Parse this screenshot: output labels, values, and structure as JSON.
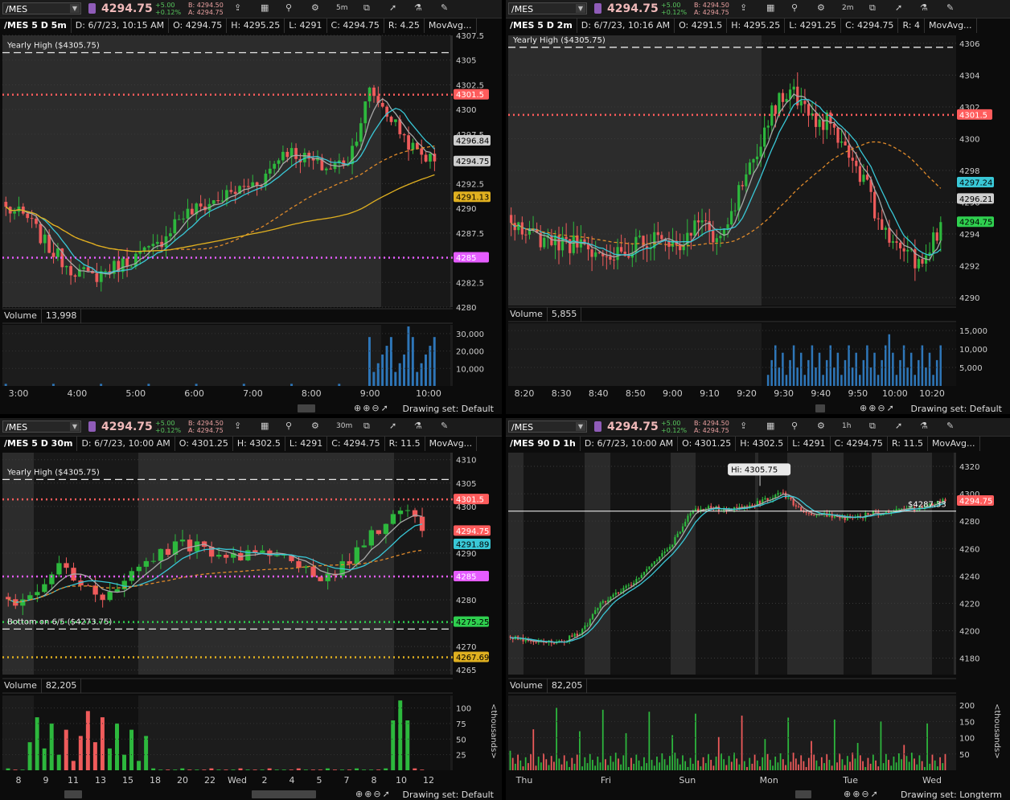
{
  "panes": [
    {
      "id": "tl",
      "symbol": "/MES",
      "last": "4294.75",
      "change": "+5.00",
      "change_pct": "+0.12%",
      "bid": "B: 4294.50",
      "ask": "A: 4294.75",
      "timeframe_btn": "5m",
      "info": {
        "title": "/MES 5 D 5m",
        "date": "D: 6/7/23, 10:15 AM",
        "open": "O: 4294.75",
        "high": "H: 4295.25",
        "low": "L: 4291",
        "close": "C: 4294.75",
        "range": "R: 4.25",
        "studies": "MovAvg..."
      },
      "volume_label": "Volume",
      "volume_value": "13,998",
      "drawing_set": "Drawing set: Default"
    },
    {
      "id": "tr",
      "symbol": "/MES",
      "last": "4294.75",
      "change": "+5.00",
      "change_pct": "+0.12%",
      "bid": "B: 4294.50",
      "ask": "A: 4294.75",
      "timeframe_btn": "2m",
      "info": {
        "title": "/MES 5 D 2m",
        "date": "D: 6/7/23, 10:16 AM",
        "open": "O: 4291.5",
        "high": "H: 4295.25",
        "low": "L: 4291.25",
        "close": "C: 4294.75",
        "range": "R: 4",
        "studies": "MovAvg..."
      },
      "volume_label": "Volume",
      "volume_value": "5,855",
      "drawing_set": "Drawing set: Default"
    },
    {
      "id": "bl",
      "symbol": "/MES",
      "last": "4294.75",
      "change": "+5.00",
      "change_pct": "+0.12%",
      "bid": "B: 4294.50",
      "ask": "A: 4294.75",
      "timeframe_btn": "30m",
      "info": {
        "title": "/MES 5 D 30m",
        "date": "D: 6/7/23, 10:00 AM",
        "open": "O: 4301.25",
        "high": "H: 4302.5",
        "low": "L: 4291",
        "close": "C: 4294.75",
        "range": "R: 11.5",
        "studies": "MovAvg..."
      },
      "volume_label": "Volume",
      "volume_value": "82,205",
      "drawing_set": "Drawing set: Default"
    },
    {
      "id": "br",
      "symbol": "/MES",
      "last": "4294.75",
      "change": "+5.00",
      "change_pct": "+0.12%",
      "bid": "B: 4294.50",
      "ask": "A: 4294.75",
      "timeframe_btn": "1h",
      "info": {
        "title": "/MES 90 D 1h",
        "date": "D: 6/7/23, 10:00 AM",
        "open": "O: 4301.25",
        "high": "H: 4302.5",
        "low": "L: 4291",
        "close": "C: 4294.75",
        "range": "R: 11.5",
        "studies": "MovAvg..."
      },
      "volume_label": "Volume",
      "volume_value": "82,205",
      "drawing_set": "Drawing set: Longterm"
    }
  ],
  "colors": {
    "up": "#2db83d",
    "down": "#ef5b5b",
    "level_red": "#ff5c5c",
    "level_magenta": "#e55cff",
    "level_green": "#2fd04f",
    "ma_gray": "#a8a8a8",
    "ma_cyan": "#39c7d6",
    "ma_yellow": "#e0b020",
    "ma_orange": "#e08a2a",
    "volume_blue": "#2e76b8"
  },
  "chart_data": [
    {
      "pane": "tl",
      "type": "candlestick",
      "price_ticks": [
        "4307.5",
        "4305",
        "4302.5",
        "4300",
        "4297.5",
        "4295",
        "4292.5",
        "4290",
        "4287.5",
        "4285",
        "4282.5",
        "4280"
      ],
      "ylim": [
        4280,
        4307.5
      ],
      "x_ticks": [
        "3:00",
        "4:00",
        "5:00",
        "6:00",
        "7:00",
        "8:00",
        "9:00",
        "10:00"
      ],
      "annotations": [
        {
          "text": "Yearly High ($4305.75)",
          "price": 4305.75
        }
      ],
      "levels": [
        {
          "price": 4301.5,
          "label": "4301.5",
          "style": "red"
        },
        {
          "price": 4285,
          "label": "4285",
          "style": "magenta"
        }
      ],
      "price_labels": [
        {
          "text": "4296.84",
          "style": "gray"
        },
        {
          "text": "4294.75",
          "style": "gray"
        },
        {
          "text": "4291.13",
          "style": "yellow"
        }
      ],
      "volume_ticks": [
        "30,000",
        "20,000",
        "10,000"
      ],
      "volume_max": 35000
    },
    {
      "pane": "tr",
      "type": "candlestick",
      "price_ticks": [
        "4306",
        "4304",
        "4302",
        "4300",
        "4298",
        "4296",
        "4294",
        "4292",
        "4290"
      ],
      "ylim": [
        4289.5,
        4306.5
      ],
      "x_ticks": [
        "8:20",
        "8:30",
        "8:40",
        "8:50",
        "9:00",
        "9:10",
        "9:20",
        "9:30",
        "9:40",
        "9:50",
        "10:00",
        "10:20"
      ],
      "annotations": [
        {
          "text": "Yearly High ($4305.75)",
          "price": 4305.75
        }
      ],
      "levels": [
        {
          "price": 4301.5,
          "label": "4301.5",
          "style": "red"
        }
      ],
      "price_labels": [
        {
          "text": "4297.24",
          "style": "cyan"
        },
        {
          "text": "4296.21",
          "style": "gray"
        },
        {
          "text": "4294.75",
          "style": "green"
        }
      ],
      "volume_ticks": [
        "15,000",
        "10,000",
        "5,000"
      ],
      "volume_max": 17000
    },
    {
      "pane": "bl",
      "type": "candlestick",
      "price_ticks": [
        "4310",
        "4305",
        "4300",
        "4295",
        "4290",
        "4285",
        "4280",
        "4275",
        "4270",
        "4265"
      ],
      "ylim": [
        4264,
        4311.5
      ],
      "x_ticks": [
        "8",
        "9",
        "11",
        "13",
        "15",
        "18",
        "20",
        "22",
        "Wed",
        "2",
        "4",
        "5",
        "7",
        "8",
        "10",
        "12"
      ],
      "annotations": [
        {
          "text": "Yearly High ($4305.75)",
          "price": 4305.75
        },
        {
          "text": "Bottom on 6/5 ($4273.75)",
          "price": 4273.75
        }
      ],
      "levels": [
        {
          "price": 4301.5,
          "label": "4301.5",
          "style": "red"
        },
        {
          "price": 4285,
          "label": "4285",
          "style": "magenta"
        },
        {
          "price": 4275.25,
          "label": "4275.25",
          "style": "green"
        },
        {
          "price": 4267.69,
          "label": "4267.69",
          "style": "yellow"
        }
      ],
      "price_labels": [
        {
          "text": "4294.75",
          "style": "red"
        },
        {
          "text": "4291.89",
          "style": "cyan"
        }
      ],
      "volume_ticks": [
        "100",
        "75",
        "50",
        "25"
      ],
      "volume_axis_label": "<thousands>",
      "volume_max": 120
    },
    {
      "pane": "br",
      "type": "candlestick",
      "price_ticks": [
        "4320",
        "4300",
        "4280",
        "4260",
        "4240",
        "4220",
        "4200",
        "4180"
      ],
      "ylim": [
        4168,
        4330
      ],
      "x_ticks": [
        "Thu",
        "Fri",
        "Sun",
        "Mon",
        "Tue",
        "Wed"
      ],
      "annotations": [
        {
          "text": "Hi: 4305.75",
          "price": 4305.75
        },
        {
          "text": "$4287.33",
          "price": 4287.33
        }
      ],
      "levels": [],
      "price_labels": [
        {
          "text": "4294.75",
          "style": "red"
        }
      ],
      "volume_ticks": [
        "200",
        "150",
        "100",
        "50"
      ],
      "volume_axis_label": "<thousands>",
      "volume_max": 230
    }
  ]
}
